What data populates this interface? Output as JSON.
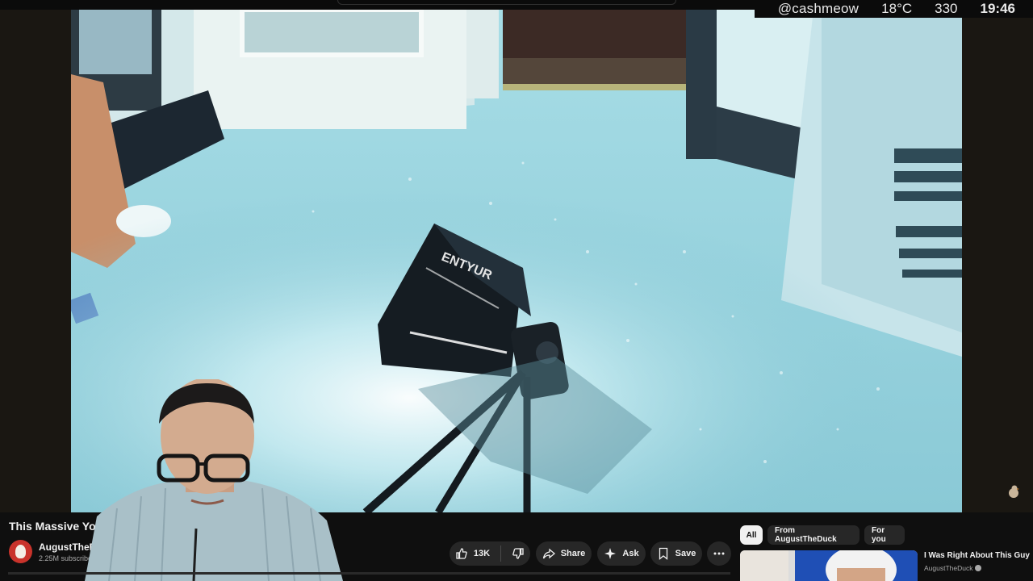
{
  "overlay": {
    "handle": "@cashmeow",
    "temperature": "18°C",
    "count": "330",
    "time": "19:46"
  },
  "video": {
    "title": "This Massive You",
    "softbox_brand": "ENTYUR"
  },
  "channel": {
    "name": "AugustTheDuc",
    "subscribers": "2.25M subscribers"
  },
  "actions": {
    "like_count": "13K",
    "share_label": "Share",
    "ask_label": "Ask",
    "save_label": "Save"
  },
  "recommendations": {
    "chips": [
      "All",
      "From AugustTheDuck",
      "For you"
    ],
    "active_chip": "All",
    "first": {
      "title": "I Was Right About This Guy",
      "channel": "AugustTheDuck"
    }
  },
  "colors": {
    "background": "#0f0f0f",
    "pill": "#272727",
    "channel_avatar": "#c9332b",
    "video_tint": "#8fc8d4"
  },
  "icons": [
    "thumbs-up-icon",
    "thumbs-down-icon",
    "share-icon",
    "sparkle-icon",
    "bookmark-icon",
    "more-icon",
    "verified-icon"
  ]
}
